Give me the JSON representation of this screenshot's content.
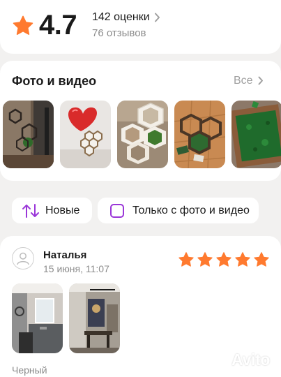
{
  "rating": {
    "value": "4.7",
    "count_label": "142 оценки",
    "reviews_label": "76 отзывов",
    "star_color": "#ff7a2f"
  },
  "media": {
    "title": "Фото и видео",
    "all_label": "Все",
    "thumbnails": [
      "hexagon-shelves-on-wall",
      "red-heart-balloon-and-hexagons",
      "white-hexagon-moss-frames",
      "wooden-hexagon-frames-on-floor",
      "moss-panel-wooden-frame"
    ]
  },
  "filters": {
    "sort_label": "Новые",
    "photo_only_label": "Только с фото и видео",
    "accent_color": "#9a36d8"
  },
  "review": {
    "author": "Наталья",
    "date": "15 июня, 11:07",
    "stars": 5,
    "text_preview": "Черный",
    "photos": [
      "kitchen-with-hexagon-decor",
      "dining-room-with-wall-art"
    ]
  },
  "watermark": {
    "text": "Avito"
  }
}
